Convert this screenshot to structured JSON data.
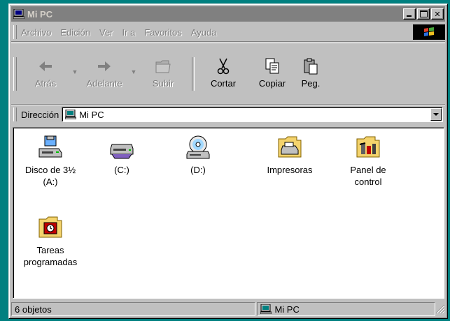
{
  "window": {
    "title": "Mi PC"
  },
  "menu": [
    "Archivo",
    "Edición",
    "Ver",
    "Ir a",
    "Favoritos",
    "Ayuda"
  ],
  "toolbar": {
    "back": "Atrás",
    "forward": "Adelante",
    "up": "Subir",
    "cut": "Cortar",
    "copy": "Copiar",
    "paste": "Peg."
  },
  "address": {
    "label": "Dirección",
    "value": "Mi PC"
  },
  "items": [
    {
      "label": "Disco de 3½ (A:)",
      "icon": "floppy-drive-icon"
    },
    {
      "label": "(C:)",
      "icon": "hard-drive-icon"
    },
    {
      "label": "(D:)",
      "icon": "cd-drive-icon"
    },
    {
      "label": "Impresoras",
      "icon": "printers-folder-icon"
    },
    {
      "label": "Panel de control",
      "icon": "control-panel-icon"
    },
    {
      "label": "Tareas programadas",
      "icon": "scheduled-tasks-icon"
    }
  ],
  "status": {
    "count": "6 objetos",
    "location": "Mi PC"
  },
  "colors": {
    "titlebar_inactive": "#808080",
    "desktop": "#008080",
    "face": "#c0c0c0"
  }
}
